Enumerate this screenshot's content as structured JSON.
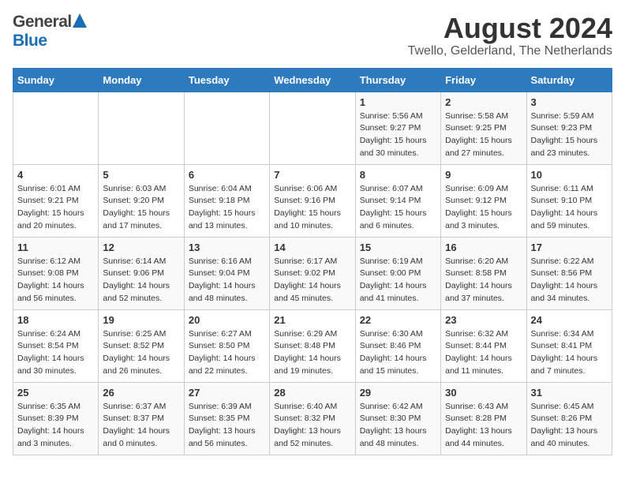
{
  "header": {
    "logo_general": "General",
    "logo_blue": "Blue",
    "main_title": "August 2024",
    "subtitle": "Twello, Gelderland, The Netherlands"
  },
  "calendar": {
    "weekdays": [
      "Sunday",
      "Monday",
      "Tuesday",
      "Wednesday",
      "Thursday",
      "Friday",
      "Saturday"
    ],
    "weeks": [
      [
        {
          "day": "",
          "sunrise": "",
          "sunset": "",
          "daylight": ""
        },
        {
          "day": "",
          "sunrise": "",
          "sunset": "",
          "daylight": ""
        },
        {
          "day": "",
          "sunrise": "",
          "sunset": "",
          "daylight": ""
        },
        {
          "day": "",
          "sunrise": "",
          "sunset": "",
          "daylight": ""
        },
        {
          "day": "1",
          "sunrise": "Sunrise: 5:56 AM",
          "sunset": "Sunset: 9:27 PM",
          "daylight": "Daylight: 15 hours and 30 minutes."
        },
        {
          "day": "2",
          "sunrise": "Sunrise: 5:58 AM",
          "sunset": "Sunset: 9:25 PM",
          "daylight": "Daylight: 15 hours and 27 minutes."
        },
        {
          "day": "3",
          "sunrise": "Sunrise: 5:59 AM",
          "sunset": "Sunset: 9:23 PM",
          "daylight": "Daylight: 15 hours and 23 minutes."
        }
      ],
      [
        {
          "day": "4",
          "sunrise": "Sunrise: 6:01 AM",
          "sunset": "Sunset: 9:21 PM",
          "daylight": "Daylight: 15 hours and 20 minutes."
        },
        {
          "day": "5",
          "sunrise": "Sunrise: 6:03 AM",
          "sunset": "Sunset: 9:20 PM",
          "daylight": "Daylight: 15 hours and 17 minutes."
        },
        {
          "day": "6",
          "sunrise": "Sunrise: 6:04 AM",
          "sunset": "Sunset: 9:18 PM",
          "daylight": "Daylight: 15 hours and 13 minutes."
        },
        {
          "day": "7",
          "sunrise": "Sunrise: 6:06 AM",
          "sunset": "Sunset: 9:16 PM",
          "daylight": "Daylight: 15 hours and 10 minutes."
        },
        {
          "day": "8",
          "sunrise": "Sunrise: 6:07 AM",
          "sunset": "Sunset: 9:14 PM",
          "daylight": "Daylight: 15 hours and 6 minutes."
        },
        {
          "day": "9",
          "sunrise": "Sunrise: 6:09 AM",
          "sunset": "Sunset: 9:12 PM",
          "daylight": "Daylight: 15 hours and 3 minutes."
        },
        {
          "day": "10",
          "sunrise": "Sunrise: 6:11 AM",
          "sunset": "Sunset: 9:10 PM",
          "daylight": "Daylight: 14 hours and 59 minutes."
        }
      ],
      [
        {
          "day": "11",
          "sunrise": "Sunrise: 6:12 AM",
          "sunset": "Sunset: 9:08 PM",
          "daylight": "Daylight: 14 hours and 56 minutes."
        },
        {
          "day": "12",
          "sunrise": "Sunrise: 6:14 AM",
          "sunset": "Sunset: 9:06 PM",
          "daylight": "Daylight: 14 hours and 52 minutes."
        },
        {
          "day": "13",
          "sunrise": "Sunrise: 6:16 AM",
          "sunset": "Sunset: 9:04 PM",
          "daylight": "Daylight: 14 hours and 48 minutes."
        },
        {
          "day": "14",
          "sunrise": "Sunrise: 6:17 AM",
          "sunset": "Sunset: 9:02 PM",
          "daylight": "Daylight: 14 hours and 45 minutes."
        },
        {
          "day": "15",
          "sunrise": "Sunrise: 6:19 AM",
          "sunset": "Sunset: 9:00 PM",
          "daylight": "Daylight: 14 hours and 41 minutes."
        },
        {
          "day": "16",
          "sunrise": "Sunrise: 6:20 AM",
          "sunset": "Sunset: 8:58 PM",
          "daylight": "Daylight: 14 hours and 37 minutes."
        },
        {
          "day": "17",
          "sunrise": "Sunrise: 6:22 AM",
          "sunset": "Sunset: 8:56 PM",
          "daylight": "Daylight: 14 hours and 34 minutes."
        }
      ],
      [
        {
          "day": "18",
          "sunrise": "Sunrise: 6:24 AM",
          "sunset": "Sunset: 8:54 PM",
          "daylight": "Daylight: 14 hours and 30 minutes."
        },
        {
          "day": "19",
          "sunrise": "Sunrise: 6:25 AM",
          "sunset": "Sunset: 8:52 PM",
          "daylight": "Daylight: 14 hours and 26 minutes."
        },
        {
          "day": "20",
          "sunrise": "Sunrise: 6:27 AM",
          "sunset": "Sunset: 8:50 PM",
          "daylight": "Daylight: 14 hours and 22 minutes."
        },
        {
          "day": "21",
          "sunrise": "Sunrise: 6:29 AM",
          "sunset": "Sunset: 8:48 PM",
          "daylight": "Daylight: 14 hours and 19 minutes."
        },
        {
          "day": "22",
          "sunrise": "Sunrise: 6:30 AM",
          "sunset": "Sunset: 8:46 PM",
          "daylight": "Daylight: 14 hours and 15 minutes."
        },
        {
          "day": "23",
          "sunrise": "Sunrise: 6:32 AM",
          "sunset": "Sunset: 8:44 PM",
          "daylight": "Daylight: 14 hours and 11 minutes."
        },
        {
          "day": "24",
          "sunrise": "Sunrise: 6:34 AM",
          "sunset": "Sunset: 8:41 PM",
          "daylight": "Daylight: 14 hours and 7 minutes."
        }
      ],
      [
        {
          "day": "25",
          "sunrise": "Sunrise: 6:35 AM",
          "sunset": "Sunset: 8:39 PM",
          "daylight": "Daylight: 14 hours and 3 minutes."
        },
        {
          "day": "26",
          "sunrise": "Sunrise: 6:37 AM",
          "sunset": "Sunset: 8:37 PM",
          "daylight": "Daylight: 14 hours and 0 minutes."
        },
        {
          "day": "27",
          "sunrise": "Sunrise: 6:39 AM",
          "sunset": "Sunset: 8:35 PM",
          "daylight": "Daylight: 13 hours and 56 minutes."
        },
        {
          "day": "28",
          "sunrise": "Sunrise: 6:40 AM",
          "sunset": "Sunset: 8:32 PM",
          "daylight": "Daylight: 13 hours and 52 minutes."
        },
        {
          "day": "29",
          "sunrise": "Sunrise: 6:42 AM",
          "sunset": "Sunset: 8:30 PM",
          "daylight": "Daylight: 13 hours and 48 minutes."
        },
        {
          "day": "30",
          "sunrise": "Sunrise: 6:43 AM",
          "sunset": "Sunset: 8:28 PM",
          "daylight": "Daylight: 13 hours and 44 minutes."
        },
        {
          "day": "31",
          "sunrise": "Sunrise: 6:45 AM",
          "sunset": "Sunset: 8:26 PM",
          "daylight": "Daylight: 13 hours and 40 minutes."
        }
      ]
    ]
  }
}
